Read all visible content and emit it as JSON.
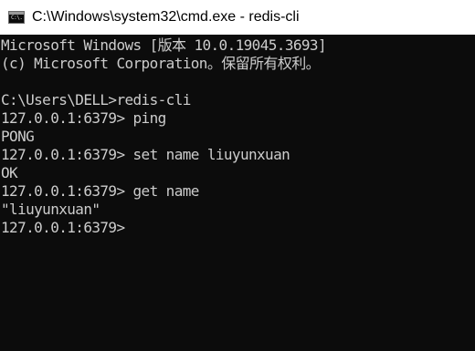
{
  "window": {
    "title": "C:\\Windows\\system32\\cmd.exe - redis-cli",
    "icon": "cmd-console-icon",
    "icon_text": "C:\\."
  },
  "console": {
    "lines": [
      "Microsoft Windows [版本 10.0.19045.3693]",
      "(c) Microsoft Corporation。保留所有权利。",
      "",
      "C:\\Users\\DELL>redis-cli",
      "127.0.0.1:6379> ping",
      "PONG",
      "127.0.0.1:6379> set name liuyunxuan",
      "OK",
      "127.0.0.1:6379> get name",
      "\"liuyunxuan\"",
      "127.0.0.1:6379>"
    ]
  },
  "colors": {
    "console_background": "#0c0c0c",
    "console_text": "#cccccc",
    "titlebar_background": "#ffffff",
    "title_text": "#000000"
  }
}
